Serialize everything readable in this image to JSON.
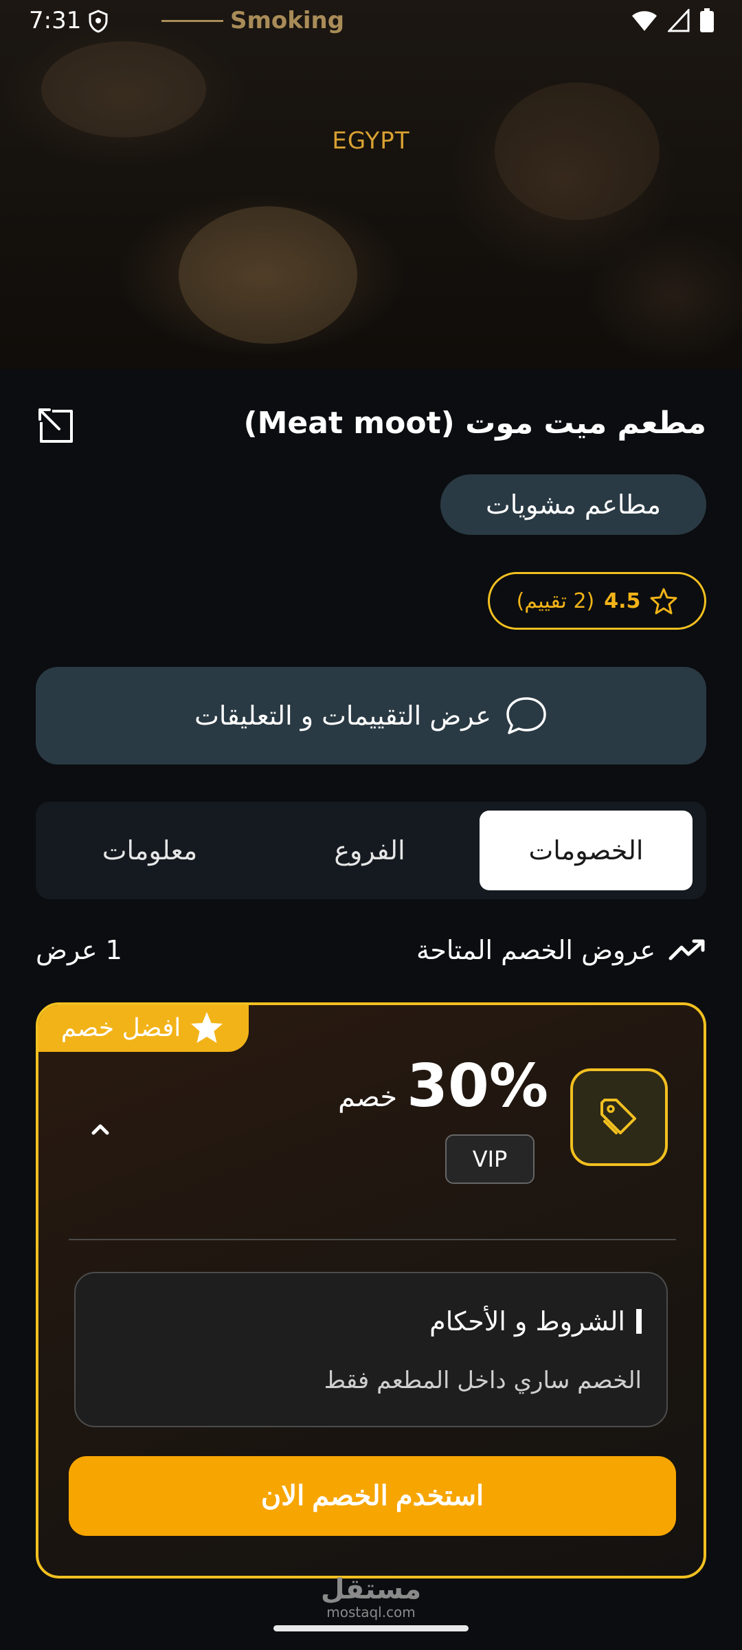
{
  "status_bar": {
    "time": "7:31"
  },
  "hero": {
    "brand": "Smoking",
    "country": "EGYPT"
  },
  "restaurant": {
    "name": "مطعم ميت موت (Meat moot)",
    "category": "مطاعم مشويات"
  },
  "rating": {
    "score": "4.5",
    "count": "(2 تقييم)"
  },
  "reviews_button": {
    "label": "عرض التقييمات و التعليقات"
  },
  "tabs": [
    {
      "label": "الخصومات",
      "active": true
    },
    {
      "label": "الفروع",
      "active": false
    },
    {
      "label": "معلومات",
      "active": false
    }
  ],
  "offers": {
    "heading": "عروض الخصم المتاحة",
    "count": "1 عرض"
  },
  "offer_card": {
    "badge": "افضل خصم",
    "discount": "30%",
    "discount_word": "خصم",
    "tier": "VIP",
    "terms_title": "الشروط و الأحكام",
    "terms_body": "الخصم ساري داخل المطعم فقط",
    "use_button": "استخدم الخصم الان"
  },
  "watermark": {
    "arabic": "مستقل",
    "latin": "mostaql.com"
  },
  "colors": {
    "accent": "#f2c020",
    "button": "#f7a500",
    "chip": "#2a3a44",
    "background": "#0b0d10"
  }
}
